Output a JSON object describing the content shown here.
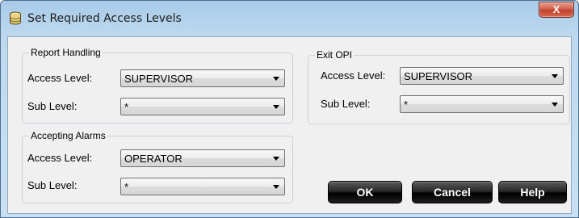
{
  "window": {
    "title": "Set Required Access Levels",
    "close_label": "X"
  },
  "groups": {
    "report_handling": {
      "label": "Report Handling",
      "access_label": "Access Level:",
      "access_value": "SUPERVISOR",
      "sub_label": "Sub Level:",
      "sub_value": "*"
    },
    "exit_opi": {
      "label": "Exit OPI",
      "access_label": "Access Level:",
      "access_value": "SUPERVISOR",
      "sub_label": "Sub Level:",
      "sub_value": "*"
    },
    "accepting_alarms": {
      "label": "Accepting Alarms",
      "access_label": "Access Level:",
      "access_value": "OPERATOR",
      "sub_label": "Sub Level:",
      "sub_value": "*"
    }
  },
  "buttons": {
    "ok": "OK",
    "cancel": "Cancel",
    "help": "Help"
  },
  "colors": {
    "titlebar": "#bdd9ef",
    "client": "#f0f0f0",
    "close": "#c0402c",
    "dark_button": "#000000"
  },
  "icons": {
    "title": "database-icon",
    "dropdown": "chevron-down-icon"
  }
}
